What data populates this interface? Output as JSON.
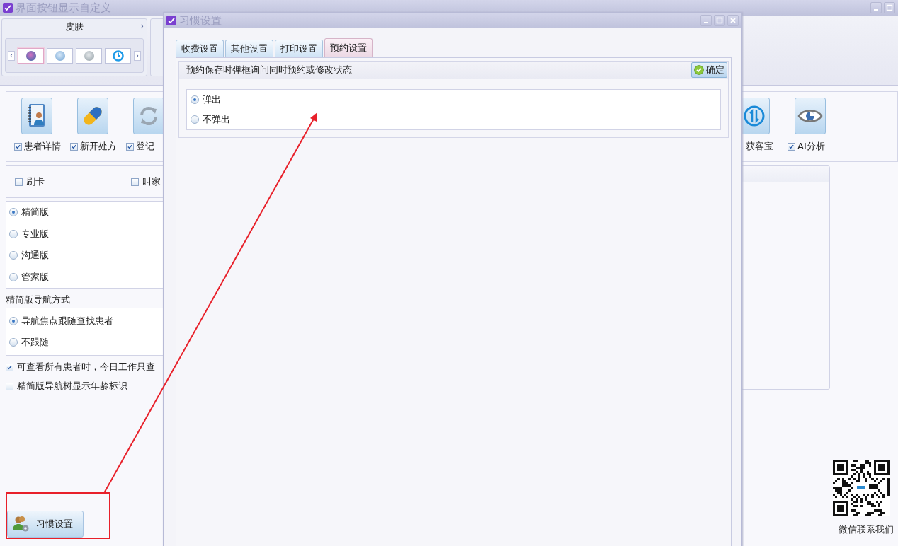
{
  "main_window": {
    "title": "界面按钮显示自定义"
  },
  "skin_panel": {
    "title": "皮肤",
    "expand_glyph": "›",
    "prev_glyph": "‹",
    "next_glyph": "›",
    "skins": [
      {
        "kind": "violet",
        "selected": true
      },
      {
        "kind": "blue",
        "selected": false
      },
      {
        "kind": "gray",
        "selected": false
      },
      {
        "kind": "dial",
        "selected": false
      }
    ]
  },
  "toolbar_left": [
    {
      "label": "患者详情",
      "checked": true,
      "kind": "contact"
    },
    {
      "label": "新开处方",
      "checked": true,
      "kind": "capsule"
    },
    {
      "label": "登记",
      "checked": true,
      "kind": "refresh"
    }
  ],
  "toolbar_right": [
    {
      "label": "获客宝",
      "kind": "exchange"
    },
    {
      "label": "AI分析",
      "checked": true,
      "kind": "eye"
    }
  ],
  "quick_options": [
    {
      "label": "刷卡",
      "checked": false
    },
    {
      "label": "叫家",
      "checked": false
    }
  ],
  "editions": [
    {
      "label": "精简版",
      "selected": true
    },
    {
      "label": "专业版",
      "selected": false
    },
    {
      "label": "沟通版",
      "selected": false
    },
    {
      "label": "管家版",
      "selected": false
    }
  ],
  "nav_mode_label": "精简版导航方式",
  "nav_modes": [
    {
      "label": "导航焦点跟随查找患者",
      "selected": true
    },
    {
      "label": "不跟随",
      "selected": false
    }
  ],
  "options": [
    {
      "label": "可查看所有患者时，今日工作只查",
      "checked": true
    },
    {
      "label": "精简版导航树显示年龄标识",
      "checked": false
    }
  ],
  "habit_button": {
    "label": "习惯设置"
  },
  "qr": {
    "caption": "微信联系我们"
  },
  "dialog": {
    "title": "习惯设置",
    "tabs": [
      {
        "label": "收费设置",
        "selected": false
      },
      {
        "label": "其他设置",
        "selected": false
      },
      {
        "label": "打印设置",
        "selected": false
      },
      {
        "label": "预约设置",
        "selected": true
      }
    ],
    "group_title": "预约保存时弹框询问同时预约或修改状态",
    "confirm_label": "确定",
    "choices": [
      {
        "label": "弹出",
        "selected": true
      },
      {
        "label": "不弹出",
        "selected": false
      }
    ]
  }
}
